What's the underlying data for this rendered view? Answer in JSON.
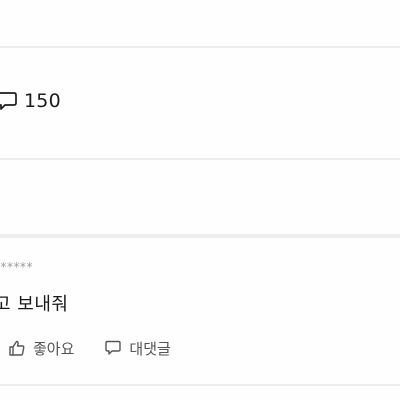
{
  "stats": {
    "comment_icon": "speech-bubble-icon",
    "comment_count": "150"
  },
  "comment": {
    "author": "******",
    "text": "고 보내줘",
    "like_icon": "thumbs-up-icon",
    "like_label": "좋아요",
    "reply_icon": "speech-bubble-icon",
    "reply_label": "대댓글"
  },
  "colors": {
    "background": "#ededed",
    "card": "#fefefe",
    "muted_text": "#9a9a9a",
    "action_text": "#555555"
  }
}
